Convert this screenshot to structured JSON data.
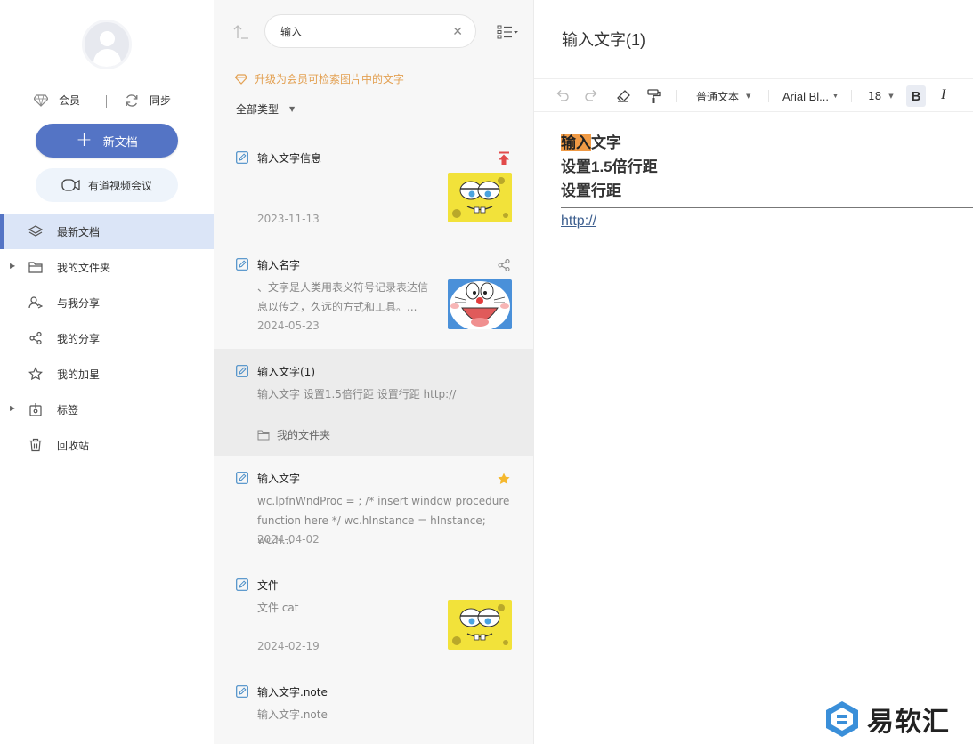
{
  "sidebar": {
    "member_label": "会员",
    "sync_label": "同步",
    "new_doc_label": "新文档",
    "meeting_label": "有道视频会议",
    "nav": [
      {
        "label": "最新文档",
        "icon": "layers-icon",
        "active": true
      },
      {
        "label": "我的文件夹",
        "icon": "folder-icon",
        "expandable": true
      },
      {
        "label": "与我分享",
        "icon": "users-share-icon"
      },
      {
        "label": "我的分享",
        "icon": "share-icon"
      },
      {
        "label": "我的加星",
        "icon": "star-icon"
      },
      {
        "label": "标签",
        "icon": "tag-icon",
        "expandable": true
      },
      {
        "label": "回收站",
        "icon": "trash-icon"
      }
    ]
  },
  "list": {
    "search_value": "输入",
    "upgrade_tip": "升级为会员可检索图片中的文字",
    "filter_label": "全部类型",
    "items": [
      {
        "title": "输入文字信息",
        "snippet": "",
        "date": "2023-11-13",
        "thumb": "sponge",
        "badge": "pin-icon"
      },
      {
        "title": "输入名字",
        "snippet": "、文字是人类用表义符号记录表达信息以传之，久远的方式和工具。...",
        "date": "2024-05-23",
        "thumb": "cat",
        "badge": "share-icon"
      },
      {
        "title": "输入文字(1)",
        "snippet": "输入文字 设置1.5倍行距 设置行距 http://",
        "folder": "我的文件夹",
        "selected": true
      },
      {
        "title": "输入文字",
        "snippet": "wc.lpfnWndProc = ; /* insert window procedure function here */ wc.hInstance = hInstance; wc.h...",
        "date": "2024-04-02",
        "badge": "star-icon"
      },
      {
        "title": "文件",
        "snippet": "文件 cat",
        "date": "2024-02-19",
        "thumb": "sponge"
      },
      {
        "title": "输入文字.note",
        "snippet": "输入文字.note",
        "date": ""
      }
    ]
  },
  "editor": {
    "title": "输入文字(1)",
    "toolbar": {
      "paragraph_style": "普通文本",
      "font": "Arial Bl...",
      "size": "18",
      "bold": "B",
      "italic": "I"
    },
    "lines": [
      {
        "highlight": "输入",
        "rest": "文字"
      },
      {
        "text": "设置1.5倍行距"
      },
      {
        "text": "设置行距"
      }
    ],
    "link": "http://"
  },
  "watermark": "易软汇",
  "colors": {
    "accent": "#5474c5",
    "upgrade": "#e3a153",
    "highlight": "#f09a45",
    "pin": "#e24a4a",
    "star": "#f5b82e"
  }
}
